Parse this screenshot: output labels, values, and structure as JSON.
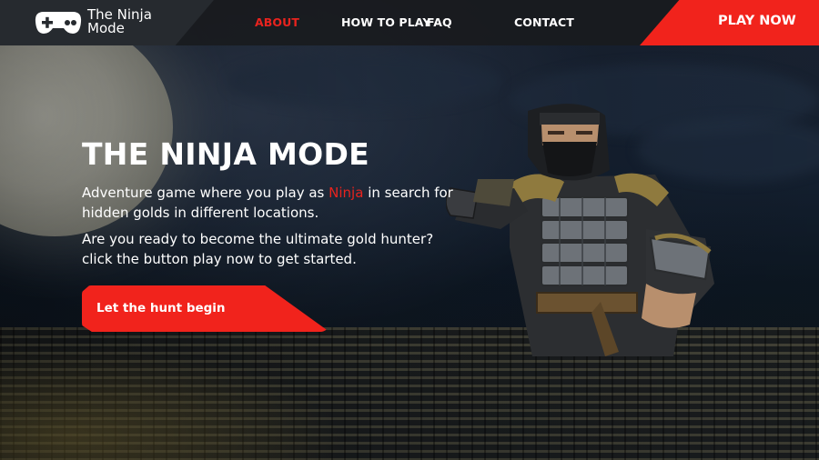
{
  "brand": {
    "line1": "The Ninja",
    "line2": "Mode",
    "logo_icon": "gamepad-icon"
  },
  "nav": {
    "items": [
      {
        "label": "ABOUT",
        "active": true
      },
      {
        "label": "HOW TO PLAY",
        "active": false
      },
      {
        "label": "FAQ",
        "active": false
      },
      {
        "label": "CONTACT",
        "active": false
      }
    ],
    "play_now": "PLAY NOW"
  },
  "hero": {
    "title": "THE NINJA MODE",
    "p1_before": "Adventure game where you play as ",
    "p1_highlight": "Ninja",
    "p1_after": " in search for hidden golds in different locations.",
    "p2": "Are you ready to become the ultimate gold hunter? click the button play now to get started.",
    "cta_label": "Let the hunt begin",
    "illustration": "ninja-character-image"
  },
  "colors": {
    "accent": "#f1231c",
    "active_link": "#e8231e",
    "navbar": "#191b1e",
    "brand_panel": "#262a2f",
    "text": "#ffffff"
  }
}
